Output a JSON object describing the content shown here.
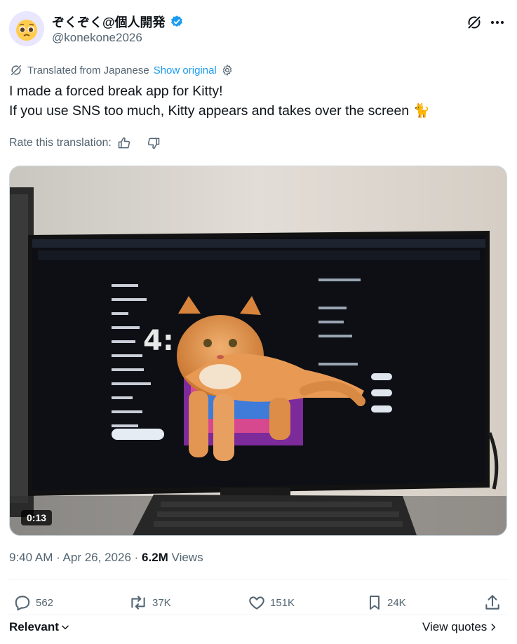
{
  "author": {
    "display_name": "ぞくぞく@個人開発",
    "handle": "@konekone2026",
    "avatar_emoji": "🥺"
  },
  "translation": {
    "label": "Translated from Japanese",
    "show_original": "Show original"
  },
  "tweet": {
    "text": "I made a forced break app for Kitty!\nIf you use SNS too much, Kitty appears and takes over the screen  🐈"
  },
  "rate": {
    "label": "Rate this translation:"
  },
  "media": {
    "duration": "0:13"
  },
  "meta": {
    "time": "9:40 AM · Apr 26, 2026 · ",
    "views_count": "6.2M",
    "views_label": " Views"
  },
  "actions": {
    "replies": "562",
    "reposts": "37K",
    "likes": "151K",
    "bookmarks": "24K"
  },
  "footer": {
    "relevant": "Relevant",
    "view_quotes": "View quotes"
  },
  "colors": {
    "accent": "#1d9bf0",
    "secondary_text": "#536471"
  }
}
